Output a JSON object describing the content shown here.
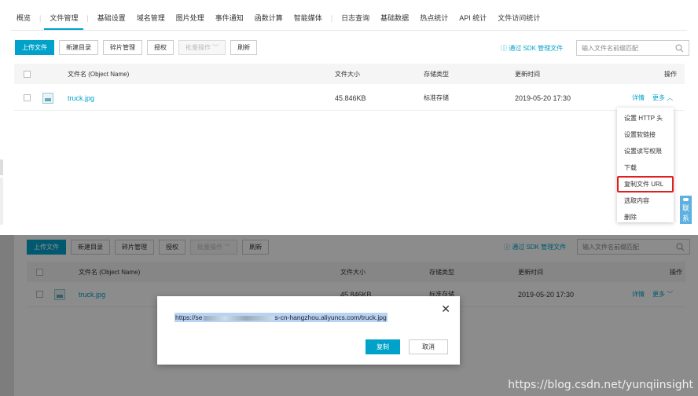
{
  "nav": {
    "tabs": [
      "概览",
      "文件管理",
      "基础设置",
      "域名管理",
      "图片处理",
      "事件通知",
      "函数计算",
      "智能媒体",
      "日志查询",
      "基础数据",
      "热点统计",
      "API 统计",
      "文件访问统计"
    ],
    "active": "文件管理"
  },
  "toolbar": {
    "upload": "上传文件",
    "new_dir": "新建目录",
    "fragments": "碎片管理",
    "authorize": "授权",
    "batch": "批量操作",
    "refresh": "刷新",
    "sdk_link": "通过 SDK 管理文件",
    "search_placeholder": "输入文件名前缀匹配"
  },
  "table": {
    "headers": {
      "name": "文件名 (Object Name)",
      "size": "文件大小",
      "storage": "存储类型",
      "updated": "更新时间",
      "actions": "操作"
    },
    "rows": [
      {
        "name": "truck.jpg",
        "size": "45.846KB",
        "storage": "标准存储",
        "updated": "2019-05-20 17:30",
        "detail": "详情",
        "more": "更多"
      }
    ]
  },
  "more_menu": {
    "items": [
      "设置 HTTP 头",
      "设置软链接",
      "设置读写权限",
      "下载",
      "复制文件 URL",
      "选取内容",
      "删除"
    ],
    "highlighted": "复制文件 URL"
  },
  "side_tab": "联系",
  "dialog": {
    "url_prefix": "https://se",
    "url_suffix": "s-cn-hangzhou.aliyuncs.com/truck.jpg",
    "copy": "复制",
    "cancel": "取消"
  },
  "watermark": "https://blog.csdn.net/yunqiinsight",
  "colors": {
    "accent": "#00a2ca",
    "highlight_border": "#e02020",
    "selection": "#b9d3f2"
  }
}
